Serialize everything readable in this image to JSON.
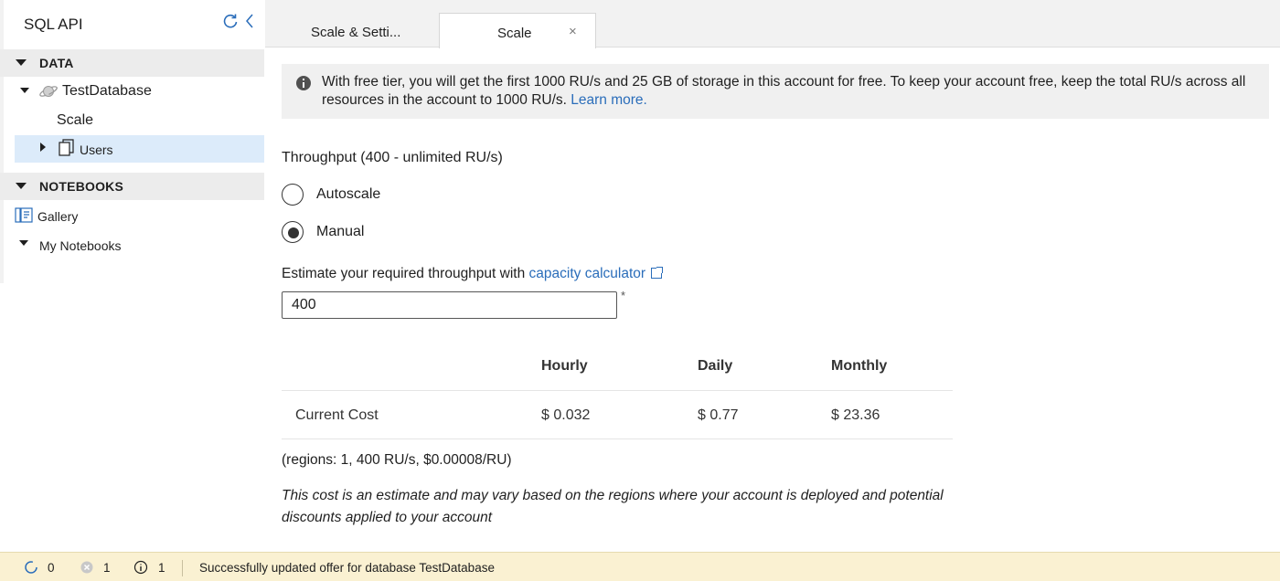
{
  "sidebar": {
    "title": "SQL API",
    "sections": {
      "data": "DATA",
      "notebooks": "NOTEBOOKS"
    },
    "database": "TestDatabase",
    "scale": "Scale",
    "collection": "Users",
    "gallery": "Gallery",
    "my_notebooks": "My Notebooks"
  },
  "tabs": [
    {
      "label": "Scale & Setti...",
      "active": false
    },
    {
      "label": "Scale",
      "active": true,
      "close": "×"
    }
  ],
  "banner": {
    "text": "With free tier, you will get the first 1000 RU/s and 25 GB of storage in this account for free. To keep your account free, keep the total RU/s across all resources in the account to 1000 RU/s.",
    "link": "Learn more."
  },
  "throughput": {
    "title": "Throughput (400 - unlimited RU/s)",
    "options": [
      "Autoscale",
      "Manual"
    ],
    "selected": "Manual",
    "estimate_label": "Estimate your required throughput with",
    "estimate_link": "capacity calculator",
    "value": "400",
    "required_mark": "*"
  },
  "cost": {
    "headers": [
      "Hourly",
      "Daily",
      "Monthly"
    ],
    "row_label": "Current Cost",
    "values": [
      "$ 0.032",
      "$ 0.77",
      "$ 23.36"
    ],
    "regions": "(regions: 1, 400 RU/s, $0.00008/RU)",
    "disclaimer": "This cost is an estimate and may vary based on the regions where your account is deployed and potential discounts applied to your account"
  },
  "status": {
    "in_progress": "0",
    "errors": "1",
    "info": "1",
    "message": "Successfully updated offer for database TestDatabase"
  },
  "colors": {
    "accent": "#2a6dba",
    "selected_row": "#dcebfa",
    "statusbar_bg": "#faf1d2"
  }
}
